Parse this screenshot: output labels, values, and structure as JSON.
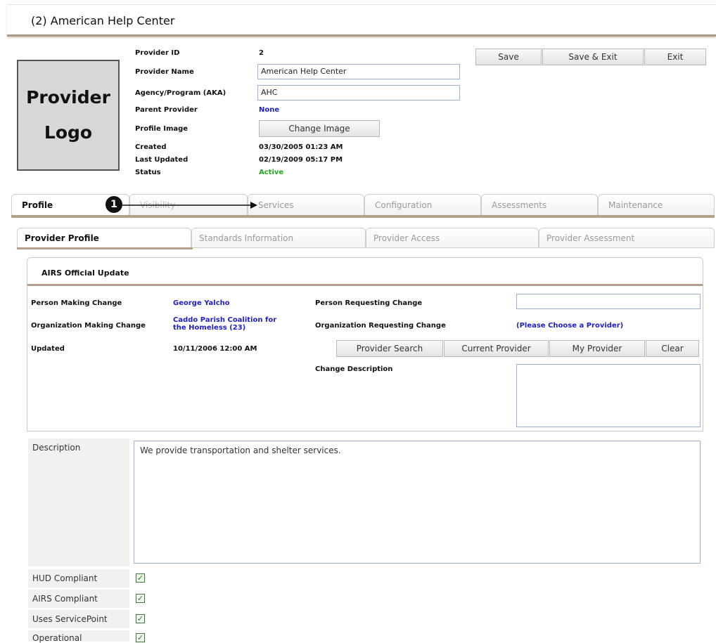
{
  "window": {
    "title": "(2) American Help Center"
  },
  "logo": {
    "line1": "Provider",
    "line2": "Logo"
  },
  "provider": {
    "id_label": "Provider ID",
    "id_value": "2",
    "name_label": "Provider Name",
    "name_value": "American Help Center",
    "aka_label": "Agency/Program (AKA)",
    "aka_value": "AHC",
    "parent_label": "Parent Provider",
    "parent_value": "None",
    "image_label": "Profile Image",
    "image_button": "Change Image",
    "created_label": "Created",
    "created_value": "03/30/2005 01:23 AM",
    "updated_label": "Last Updated",
    "updated_value": "02/19/2009 05:17 PM",
    "status_label": "Status",
    "status_value": "Active"
  },
  "toolbar": {
    "save": "Save",
    "save_exit": "Save & Exit",
    "exit": "Exit"
  },
  "tabs": [
    "Profile",
    "Visibility",
    "Services",
    "Configuration",
    "Assessments",
    "Maintenance"
  ],
  "annotation": {
    "number": "1"
  },
  "subtabs": [
    "Provider Profile",
    "Standards Information",
    "Provider Access",
    "Provider Assessment"
  ],
  "airs": {
    "title": "AIRS Official Update",
    "person_making_label": "Person Making Change",
    "person_making_value": "George Yalcho",
    "org_making_label": "Organization Making Change",
    "org_making_value_line1": "Caddo Parish Coalition for",
    "org_making_value_line2": "the Homeless (23)",
    "updated_label": "Updated",
    "updated_value": "10/11/2006 12:00 AM",
    "person_requesting_label": "Person Requesting Change",
    "person_requesting_value": "",
    "org_requesting_label": "Organization Requesting Change",
    "org_requesting_value": "(Please Choose a Provider)",
    "buttons": {
      "provider_search": "Provider Search",
      "current_provider": "Current Provider",
      "my_provider": "My Provider",
      "clear": "Clear"
    },
    "change_description_label": "Change Description",
    "change_description_value": ""
  },
  "description": {
    "label": "Description",
    "value": "We provide transportation and shelter services."
  },
  "flags": [
    {
      "label": "HUD Compliant",
      "checked": true
    },
    {
      "label": "AIRS Compliant",
      "checked": true
    },
    {
      "label": "Uses ServicePoint",
      "checked": true
    },
    {
      "label": "Operational",
      "checked": true
    }
  ],
  "colors": {
    "accent_line": "#b3a18c",
    "link_blue": "#2020c8",
    "status_green": "#22aa22"
  }
}
